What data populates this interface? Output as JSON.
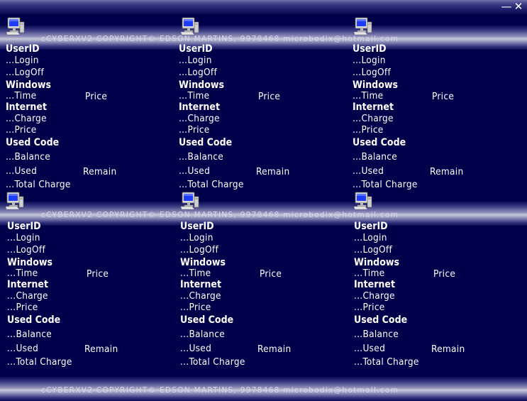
{
  "window": {
    "minimize_glyph": "—",
    "close_glyph": "✕"
  },
  "copyright": "cCYBERXV2 COPYRIGHT© EDSON MARTINS, 9978468  microbodix@hotmail.com",
  "icon": "computer-monitor-icon",
  "stations": [
    {
      "userid": "UserID",
      "login": "...Login",
      "logoff": "...LogOff",
      "windows": "Windows",
      "time": "...Time",
      "price_header": "Price",
      "internet": "Internet",
      "charge": "...Charge",
      "price": "...Price",
      "used_code": "Used Code",
      "balance": "...Balance",
      "used": "...Used",
      "remain": "Remain",
      "total_charge": "...Total Charge"
    },
    {
      "userid": "UserID",
      "login": "...Login",
      "logoff": "...LogOff",
      "windows": "Windows",
      "time": "...Time",
      "price_header": "Price",
      "internet": "Internet",
      "charge": "...Charge",
      "price": "...Price",
      "used_code": "Used Code",
      "balance": "...Balance",
      "used": "...Used",
      "remain": "Remain",
      "total_charge": "...Total Charge"
    },
    {
      "userid": "UserID",
      "login": "...Login",
      "logoff": "...LogOff",
      "windows": "Windows",
      "time": "...Time",
      "price_header": "Price",
      "internet": "Internet",
      "charge": "...Charge",
      "price": "...Price",
      "used_code": "Used Code",
      "balance": "...Balance",
      "used": "...Used",
      "remain": "Remain",
      "total_charge": "...Total Charge"
    },
    {
      "userid": "UserID",
      "login": "...Login",
      "logoff": "...LogOff",
      "windows": "Windows",
      "time": "...Time",
      "price_header": "Price",
      "internet": "Internet",
      "charge": "...Charge",
      "price": "...Price",
      "used_code": "Used Code",
      "balance": "...Balance",
      "used": "...Used",
      "remain": "Remain",
      "total_charge": "...Total Charge"
    },
    {
      "userid": "UserID",
      "login": "...Login",
      "logoff": "...LogOff",
      "windows": "Windows",
      "time": "...Time",
      "price_header": "Price",
      "internet": "Internet",
      "charge": "...Charge",
      "price": "...Price",
      "used_code": "Used Code",
      "balance": "...Balance",
      "used": "...Used",
      "remain": "Remain",
      "total_charge": "...Total Charge"
    },
    {
      "userid": "UserID",
      "login": "...Login",
      "logoff": "...LogOff",
      "windows": "Windows",
      "time": "...Time",
      "price_header": "Price",
      "internet": "Internet",
      "charge": "...Charge",
      "price": "...Price",
      "used_code": "Used Code",
      "balance": "...Balance",
      "used": "...Used",
      "remain": "Remain",
      "total_charge": "...Total Charge"
    }
  ]
}
